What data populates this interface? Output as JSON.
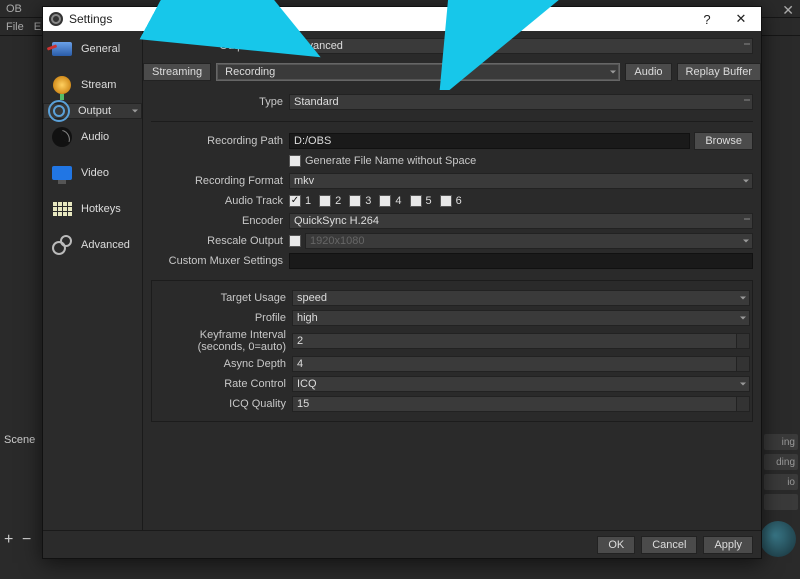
{
  "bg": {
    "title_prefix": "OB",
    "menu": {
      "file": "File",
      "edit": "E"
    },
    "scene_label": "Scene",
    "right_items": [
      "ing",
      "ding",
      "io",
      ""
    ]
  },
  "dialog": {
    "title": "Settings",
    "help": "?",
    "close": "✕"
  },
  "sidebar": {
    "items": [
      {
        "label": "General"
      },
      {
        "label": "Stream"
      },
      {
        "label": "Output"
      },
      {
        "label": "Audio"
      },
      {
        "label": "Video"
      },
      {
        "label": "Hotkeys"
      },
      {
        "label": "Advanced"
      }
    ]
  },
  "output": {
    "mode_label": "Output Mode",
    "mode_value": "Advanced",
    "tabs": {
      "streaming": "Streaming",
      "recording": "Recording",
      "audio": "Audio",
      "replay": "Replay Buffer"
    },
    "type_label": "Type",
    "type_value": "Standard",
    "path_label": "Recording Path",
    "path_value": "D:/OBS",
    "browse": "Browse",
    "nospace_label": "Generate File Name without Space",
    "format_label": "Recording Format",
    "format_value": "mkv",
    "track_label": "Audio Track",
    "tracks": [
      "1",
      "2",
      "3",
      "4",
      "5",
      "6"
    ],
    "encoder_label": "Encoder",
    "encoder_value": "QuickSync H.264",
    "rescale_label": "Rescale Output",
    "rescale_placeholder": "1920x1080",
    "muxer_label": "Custom Muxer Settings",
    "muxer_value": ""
  },
  "encoder": {
    "target_label": "Target Usage",
    "target_value": "speed",
    "profile_label": "Profile",
    "profile_value": "high",
    "keyframe_label": "Keyframe Interval (seconds, 0=auto)",
    "keyframe_value": "2",
    "async_label": "Async Depth",
    "async_value": "4",
    "rate_label": "Rate Control",
    "rate_value": "ICQ",
    "icq_label": "ICQ Quality",
    "icq_value": "15"
  },
  "buttons": {
    "ok": "OK",
    "cancel": "Cancel",
    "apply": "Apply"
  }
}
